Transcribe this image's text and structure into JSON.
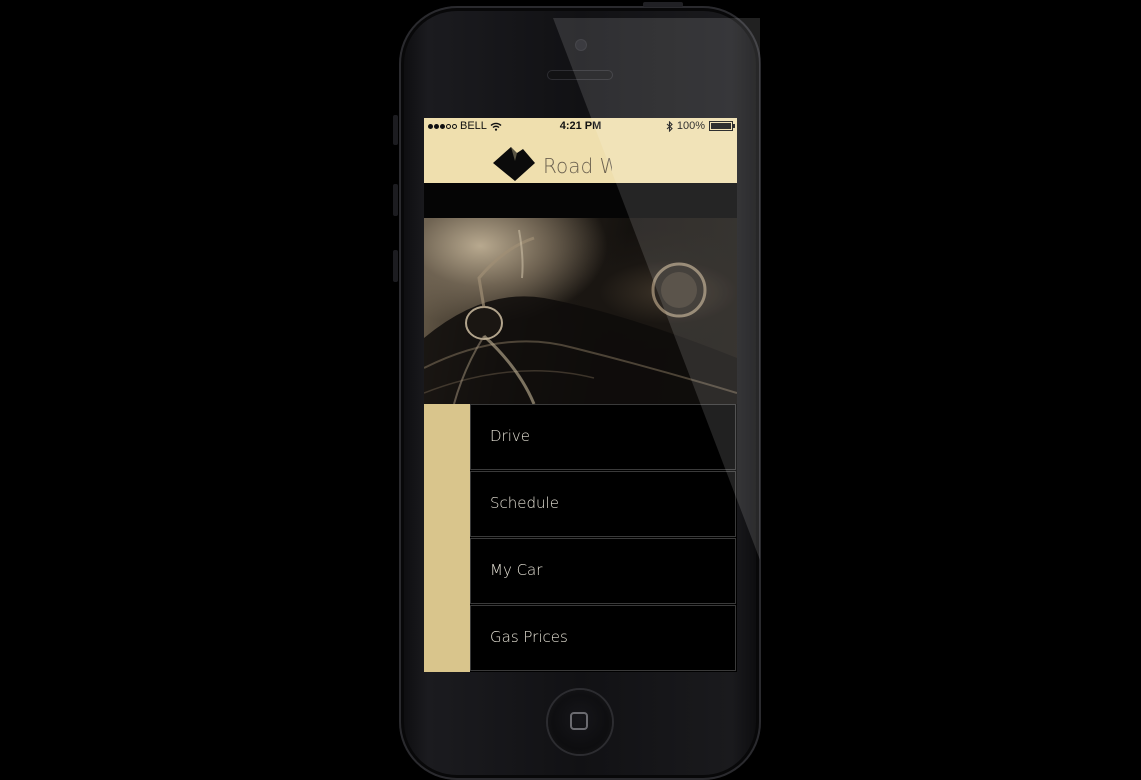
{
  "status_bar": {
    "carrier": "BELL",
    "time": "4:21 PM",
    "battery": "100%",
    "signal_bars_filled": 3,
    "signal_bars_total": 5
  },
  "header": {
    "app_title": "Road W",
    "logo_icon": "road-logo-icon"
  },
  "menu": {
    "items": [
      {
        "label": "Drive"
      },
      {
        "label": "Schedule"
      },
      {
        "label": "My Car"
      },
      {
        "label": "Gas Prices"
      }
    ]
  },
  "colors": {
    "header_bg": "#efdfae",
    "accent_bar": "#d9c58c",
    "menu_bg": "#000000",
    "menu_text": "#e6e2d6"
  }
}
